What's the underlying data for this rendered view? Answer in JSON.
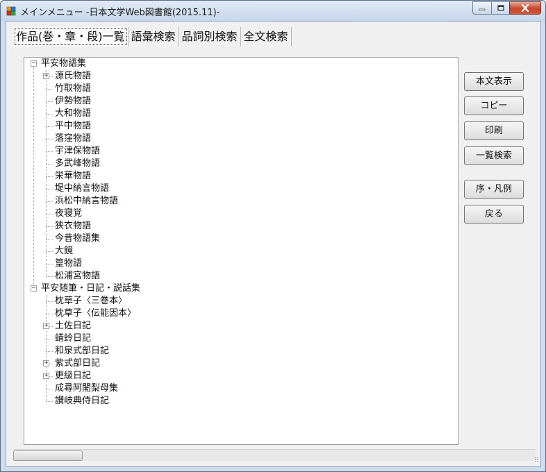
{
  "window": {
    "title": "メインメニュー -日本文学Web図書館(2015.11)-"
  },
  "tabs": [
    {
      "label": "作品(巻・章・段)一覧",
      "active": true
    },
    {
      "label": "語彙検索",
      "active": false
    },
    {
      "label": "品詞別検索",
      "active": false
    },
    {
      "label": "全文検索",
      "active": false
    }
  ],
  "tree": {
    "groups": [
      {
        "label": "平安物語集",
        "expanded": true,
        "children": [
          {
            "label": "源氏物語",
            "has_children": true
          },
          {
            "label": "竹取物語",
            "has_children": false
          },
          {
            "label": "伊勢物語",
            "has_children": false
          },
          {
            "label": "大和物語",
            "has_children": false
          },
          {
            "label": "平中物語",
            "has_children": false
          },
          {
            "label": "落窪物語",
            "has_children": false
          },
          {
            "label": "宇津保物語",
            "has_children": false
          },
          {
            "label": "多武峰物語",
            "has_children": false
          },
          {
            "label": "栄華物語",
            "has_children": false
          },
          {
            "label": "堤中納言物語",
            "has_children": false
          },
          {
            "label": "浜松中納言物語",
            "has_children": false
          },
          {
            "label": "夜寝覚",
            "has_children": false
          },
          {
            "label": "狭衣物語",
            "has_children": false
          },
          {
            "label": "今昔物語集",
            "has_children": false
          },
          {
            "label": "大鏡",
            "has_children": false
          },
          {
            "label": "篁物語",
            "has_children": false
          },
          {
            "label": "松浦宮物語",
            "has_children": false
          }
        ]
      },
      {
        "label": "平安随筆・日記・説話集",
        "expanded": true,
        "children": [
          {
            "label": "枕草子〈三巻本〉",
            "has_children": false
          },
          {
            "label": "枕草子〈伝能因本〉",
            "has_children": false
          },
          {
            "label": "土佐日記",
            "has_children": true
          },
          {
            "label": "蜻蛉日記",
            "has_children": false
          },
          {
            "label": "和泉式部日記",
            "has_children": false
          },
          {
            "label": "紫式部日記",
            "has_children": true
          },
          {
            "label": "更級日記",
            "has_children": true
          },
          {
            "label": "成尋阿闍梨母集",
            "has_children": false
          },
          {
            "label": "讃岐典侍日記",
            "has_children": false
          }
        ]
      }
    ]
  },
  "buttons": {
    "show_text": "本文表示",
    "copy": "コピー",
    "print": "印刷",
    "list_search": "一覧検索",
    "preface": "序・凡例",
    "back": "戻る"
  },
  "colors": {
    "title_bar": "#c6d6ea",
    "close_button": "#c7452c",
    "tree_background": "#ffffff",
    "client_background": "#f0f0f0"
  }
}
